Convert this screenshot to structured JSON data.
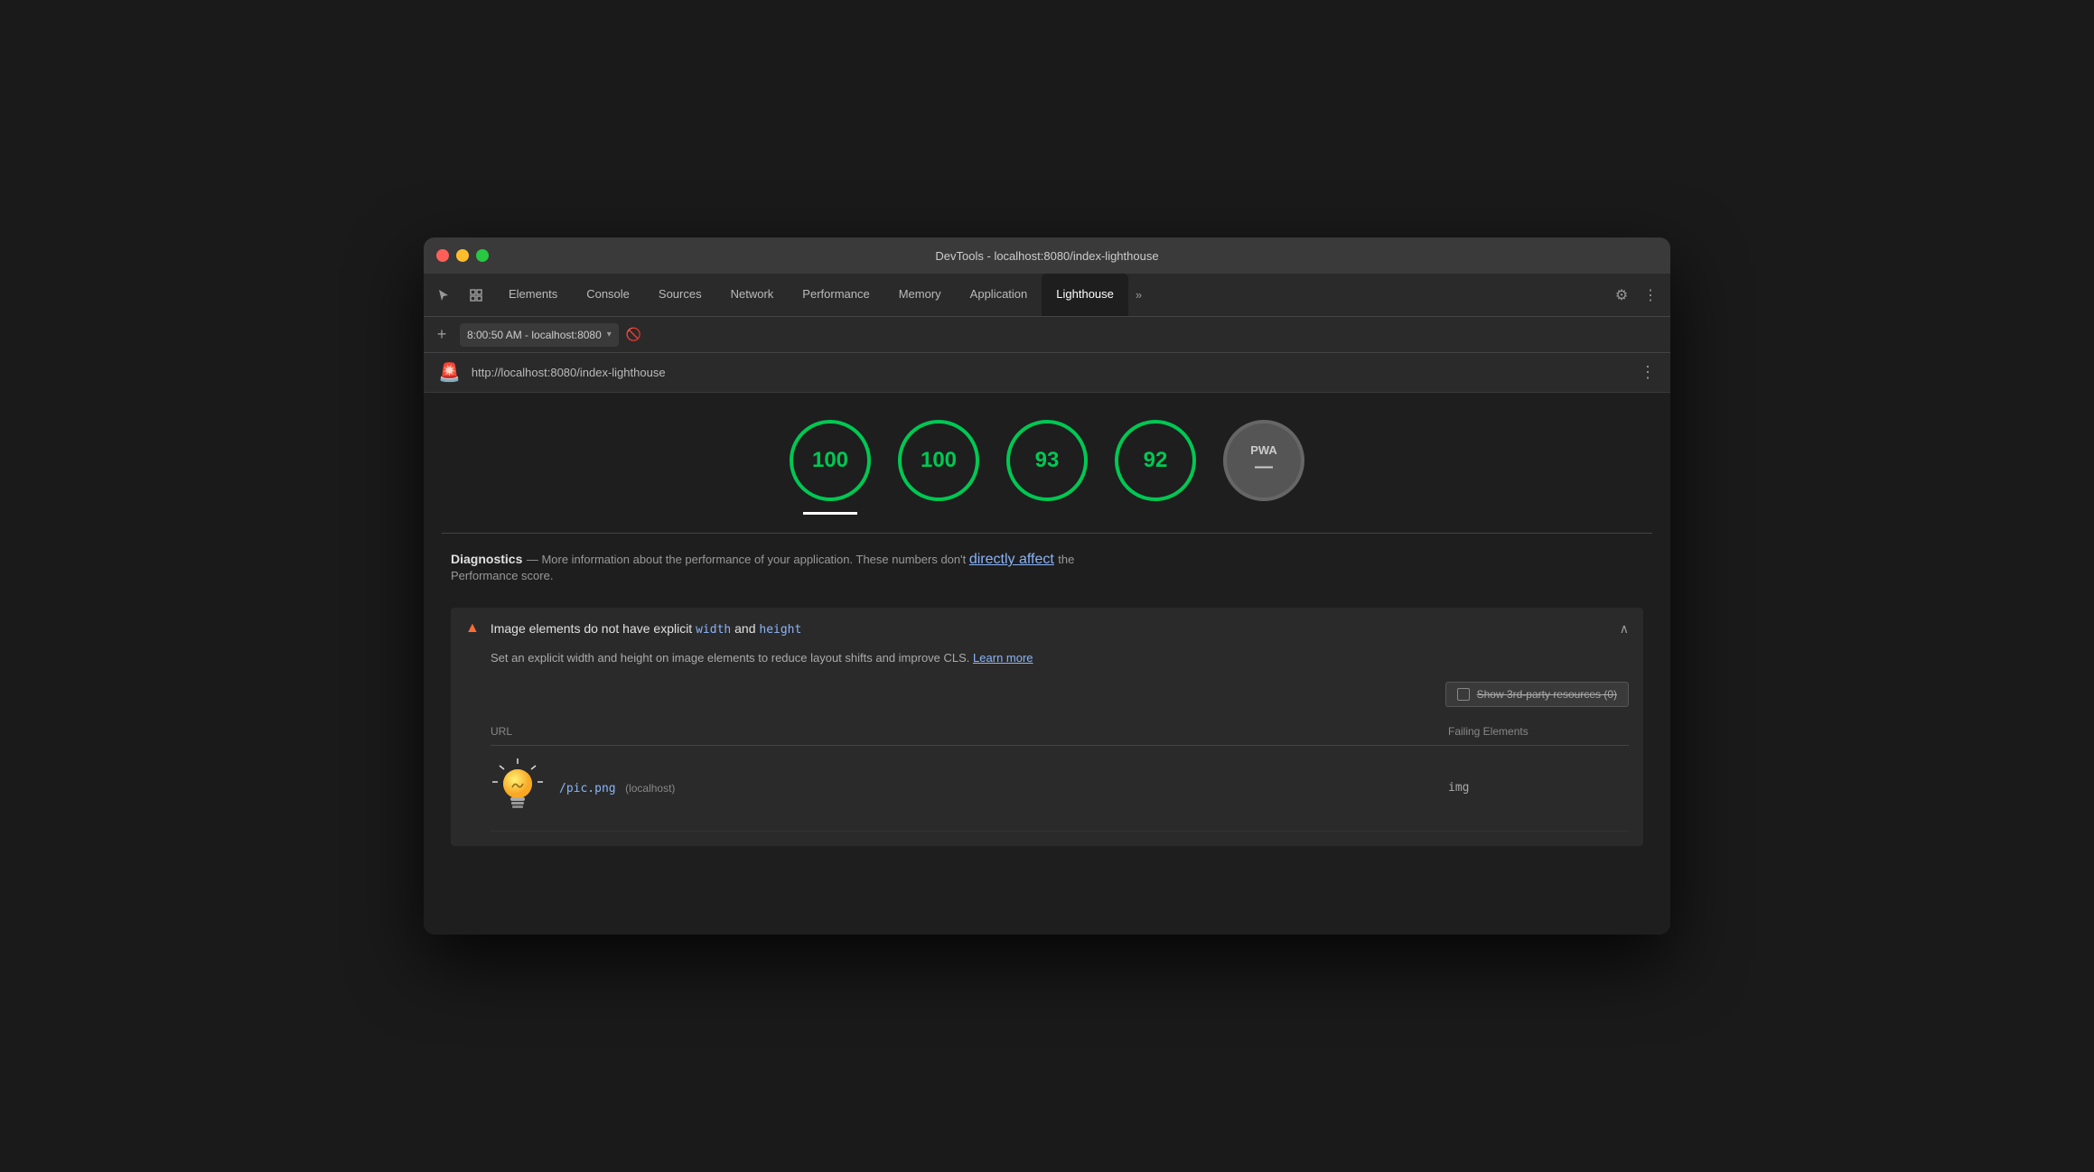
{
  "window": {
    "title": "DevTools - localhost:8080/index-lighthouse"
  },
  "tabs": {
    "items": [
      {
        "id": "elements",
        "label": "Elements",
        "active": false
      },
      {
        "id": "console",
        "label": "Console",
        "active": false
      },
      {
        "id": "sources",
        "label": "Sources",
        "active": false
      },
      {
        "id": "network",
        "label": "Network",
        "active": false
      },
      {
        "id": "performance",
        "label": "Performance",
        "active": false
      },
      {
        "id": "memory",
        "label": "Memory",
        "active": false
      },
      {
        "id": "application",
        "label": "Application",
        "active": false
      },
      {
        "id": "lighthouse",
        "label": "Lighthouse",
        "active": true
      }
    ],
    "more_label": "»"
  },
  "address_bar": {
    "url_text": "8:00:50 AM - localhost:8080",
    "dropdown_arrow": "▾"
  },
  "lighthouse_bar": {
    "url": "http://localhost:8080/index-lighthouse",
    "icon": "🚨"
  },
  "scores": [
    {
      "id": "performance",
      "value": "100",
      "type": "green",
      "underline": true
    },
    {
      "id": "accessibility",
      "value": "100",
      "type": "green",
      "underline": false
    },
    {
      "id": "best-practices",
      "value": "93",
      "type": "green",
      "underline": false
    },
    {
      "id": "seo",
      "value": "92",
      "type": "green",
      "underline": false
    },
    {
      "id": "pwa",
      "value": "PWA",
      "dash": "—",
      "type": "dark-gray",
      "underline": false
    }
  ],
  "diagnostics": {
    "title": "Diagnostics",
    "separator": " — ",
    "description_before": "More information about the performance of your application. These numbers don't ",
    "link_text": "directly affect",
    "description_after": " the",
    "description_line2": "Performance score."
  },
  "audit": {
    "warning_icon": "▲",
    "title_before": "Image elements do not have explicit ",
    "title_width": "width",
    "title_and": " and ",
    "title_height": "height",
    "chevron": "∧",
    "description": "Set an explicit width and height on image elements to reduce layout shifts and improve CLS.",
    "learn_more": "Learn more",
    "third_party": {
      "label": "Show 3rd-party resources (0)"
    },
    "table": {
      "col_url": "URL",
      "col_failing": "Failing Elements",
      "rows": [
        {
          "url": "/pic.png",
          "origin": "(localhost)",
          "failing_element": "img"
        }
      ]
    }
  }
}
